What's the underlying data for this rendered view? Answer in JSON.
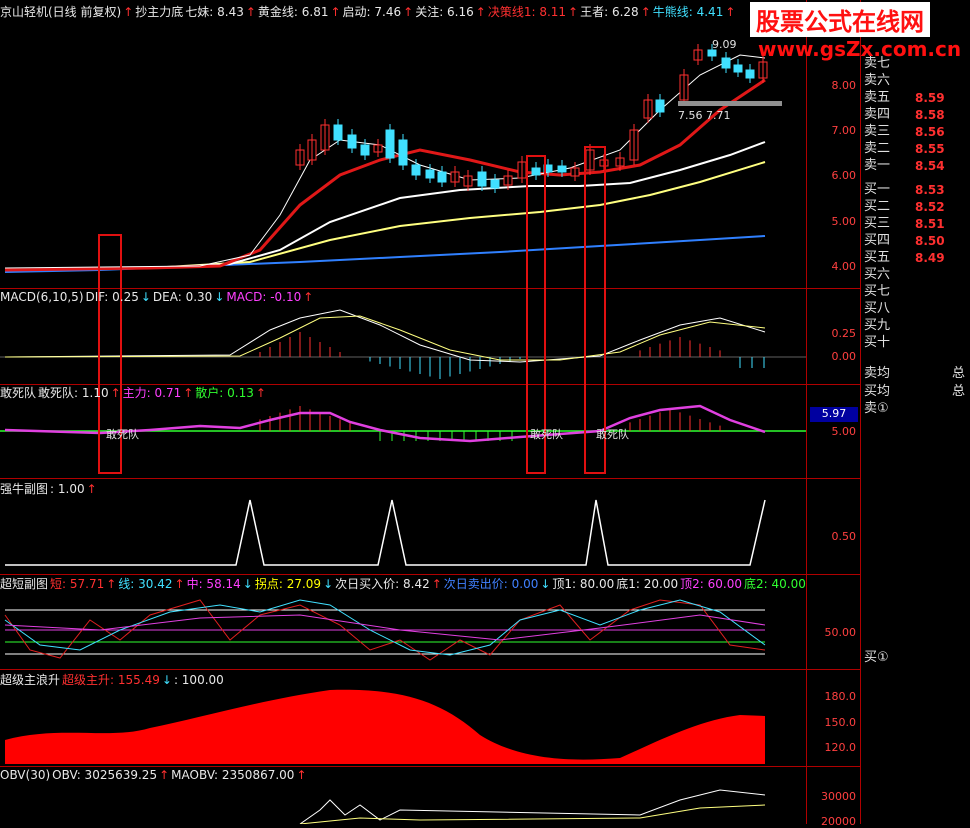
{
  "headers": {
    "main": [
      {
        "t": "京山轻机(日线 前复权)",
        "c": "w"
      },
      {
        "t": "↑",
        "c": "up"
      },
      {
        "t": "抄主力底",
        "c": "w"
      },
      {
        "t": "七妹: 8.43",
        "c": "w"
      },
      {
        "t": "↑",
        "c": "up"
      },
      {
        "t": "黄金线: 6.81",
        "c": "w"
      },
      {
        "t": "↑",
        "c": "up"
      },
      {
        "t": "启动: 7.46",
        "c": "w"
      },
      {
        "t": "↑",
        "c": "up"
      },
      {
        "t": "关注: 6.16",
        "c": "w"
      },
      {
        "t": "↑",
        "c": "up"
      },
      {
        "t": "决策线1: 8.11",
        "c": "r"
      },
      {
        "t": "↑",
        "c": "up"
      },
      {
        "t": "王者: 6.28",
        "c": "w"
      },
      {
        "t": "↑",
        "c": "up"
      },
      {
        "t": "牛熊线: 4.41",
        "c": "c"
      },
      {
        "t": "↑",
        "c": "up"
      }
    ],
    "macd": [
      {
        "t": "MACD(6,10,5)",
        "c": "w"
      },
      {
        "t": "DIF: 0.25",
        "c": "w"
      },
      {
        "t": "↓",
        "c": "dn"
      },
      {
        "t": "DEA: 0.30",
        "c": "w"
      },
      {
        "t": "↓",
        "c": "dn"
      },
      {
        "t": "MACD: -0.10",
        "c": "m"
      },
      {
        "t": "↑",
        "c": "up"
      }
    ],
    "dare": [
      {
        "t": "敢死队",
        "c": "w"
      },
      {
        "t": "敢死队: 1.10",
        "c": "w"
      },
      {
        "t": "↑",
        "c": "up"
      },
      {
        "t": "主力: 0.71",
        "c": "m"
      },
      {
        "t": "↑",
        "c": "up"
      },
      {
        "t": "散户: 0.13",
        "c": "g"
      },
      {
        "t": "↑",
        "c": "up"
      }
    ],
    "bull": [
      {
        "t": "强牛副图",
        "c": "w"
      },
      {
        "t": ": 1.00",
        "c": "w"
      },
      {
        "t": "↑",
        "c": "up"
      }
    ],
    "super": [
      {
        "t": "超短副图",
        "c": "w"
      },
      {
        "t": "短: 57.71",
        "c": "r"
      },
      {
        "t": "↑",
        "c": "up"
      },
      {
        "t": "线: 30.42",
        "c": "c"
      },
      {
        "t": "↑",
        "c": "up"
      },
      {
        "t": "中: 58.14",
        "c": "m"
      },
      {
        "t": "↓",
        "c": "dn"
      },
      {
        "t": "拐点: 27.09",
        "c": "y"
      },
      {
        "t": "↓",
        "c": "dn"
      },
      {
        "t": "次日买入价: 8.42",
        "c": "w"
      },
      {
        "t": "↑",
        "c": "up"
      },
      {
        "t": "次日卖出价: 0.00",
        "c": "b"
      },
      {
        "t": "↓",
        "c": "dn"
      },
      {
        "t": "顶1: 80.00",
        "c": "w"
      },
      {
        "t": "底1: 20.00",
        "c": "w"
      },
      {
        "t": "顶2: 60.00",
        "c": "m"
      },
      {
        "t": "底2: 40.00",
        "c": "g"
      }
    ],
    "wave": [
      {
        "t": "超级主浪升",
        "c": "w"
      },
      {
        "t": "超级主升: 155.49",
        "c": "r"
      },
      {
        "t": "↓",
        "c": "dn"
      },
      {
        "t": ": 100.00",
        "c": "w"
      }
    ],
    "obv": [
      {
        "t": "OBV(30)",
        "c": "w"
      },
      {
        "t": "OBV: 3025639.25",
        "c": "w"
      },
      {
        "t": "↑",
        "c": "up"
      },
      {
        "t": "MAOBV: 2350867.00",
        "c": "w"
      },
      {
        "t": "↑",
        "c": "up"
      }
    ]
  },
  "axes": {
    "main": [
      "8.00",
      "7.00",
      "6.00",
      "5.00",
      "4.00"
    ],
    "macd": [
      "0.25",
      "0.00"
    ],
    "dare": [
      "5.00"
    ],
    "bull": [
      "0.50"
    ],
    "super": [
      "50.00"
    ],
    "wave": [
      "180.0",
      "150.0",
      "120.0"
    ],
    "obv": [
      "30000",
      "20000"
    ]
  },
  "orderbook": {
    "sell": [
      {
        "label": "卖七",
        "price": ""
      },
      {
        "label": "卖六",
        "price": ""
      },
      {
        "label": "卖五",
        "price": "8.59"
      },
      {
        "label": "卖四",
        "price": "8.58"
      },
      {
        "label": "卖三",
        "price": "8.56"
      },
      {
        "label": "卖二",
        "price": "8.55"
      },
      {
        "label": "卖一",
        "price": "8.54"
      }
    ],
    "buy": [
      {
        "label": "买一",
        "price": "8.53"
      },
      {
        "label": "买二",
        "price": "8.52"
      },
      {
        "label": "买三",
        "price": "8.51"
      },
      {
        "label": "买四",
        "price": "8.50"
      },
      {
        "label": "买五",
        "price": "8.49"
      },
      {
        "label": "买六",
        "price": ""
      },
      {
        "label": "买七",
        "price": ""
      },
      {
        "label": "买八",
        "price": ""
      },
      {
        "label": "买九",
        "price": ""
      },
      {
        "label": "买十",
        "price": ""
      }
    ],
    "avg_sell": "卖均",
    "avg_buy": "买均",
    "total1": "总",
    "total2": "总",
    "sell_one": "卖①",
    "buy_one": "买①"
  },
  "badge": "5.97",
  "price_labels": {
    "high": "9.09",
    "low_left": "7.56",
    "low_right": "7.71"
  },
  "dare_labels": [
    "敢死队",
    "敢死队",
    "敢死队"
  ],
  "brand": {
    "cn": "股票公式在线网",
    "url": "www.gsZx.com.cn"
  },
  "colors": {
    "bg": "#000000",
    "grid": "#b00000",
    "up": "#ff3030",
    "down": "#40e0ff"
  }
}
